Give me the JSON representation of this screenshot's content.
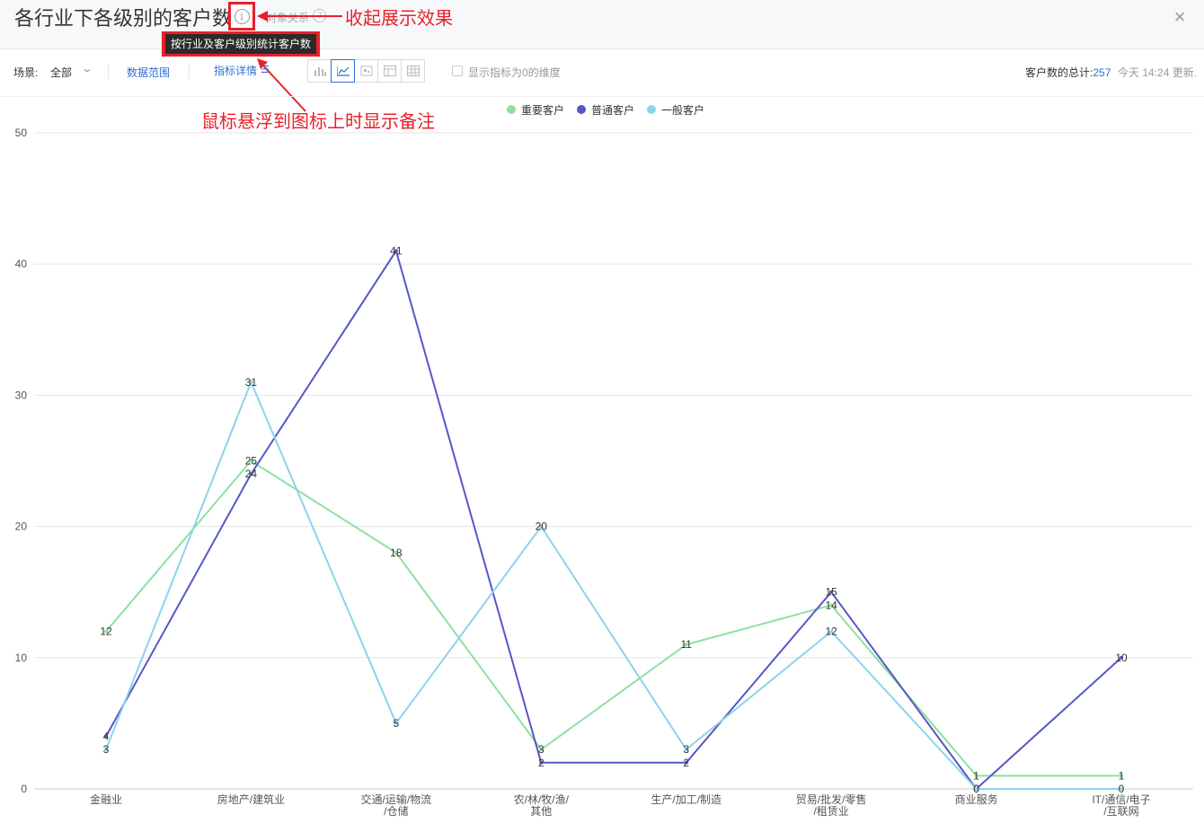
{
  "header": {
    "title": "各行业下各级别的客户数",
    "sub_label": "对象关系",
    "tooltip": "按行业及客户级别统计客户数",
    "annotation_collapse": "收起展示效果",
    "annotation_hover": "鼠标悬浮到图标上时显示备注"
  },
  "toolbar": {
    "scene_label": "场景:",
    "scene_value": "全部",
    "data_range": "数据范围",
    "metric_detail": "指标详情",
    "zero_checkbox_label": "显示指标为0的维度",
    "total_label": "客户数的总计:",
    "total_value": "257",
    "updated": "今天 14:24 更新."
  },
  "icons": [
    "info-icon",
    "help-icon",
    "close-icon",
    "chevron-down-icon",
    "list-icon",
    "bar-chart-icon",
    "line-chart-icon",
    "scatter-icon",
    "table-icon",
    "grid-icon"
  ],
  "colors": {
    "accent": "#2f6fd4",
    "annotation_red": "#e8202a",
    "series_important": "#8ee0a2",
    "series_normal": "#5558c8",
    "series_general": "#8dd3ec"
  },
  "chart_data": {
    "type": "line",
    "categories": [
      "金融业",
      "房地产/建筑业",
      "交通/运输/物流/仓储",
      "农/林/牧/渔/其他",
      "生产/加工/制造",
      "贸易/批发/零售/租赁业",
      "商业服务",
      "IT/通信/电子/互联网"
    ],
    "category_lines": [
      [
        "金融业"
      ],
      [
        "房地产/建筑业"
      ],
      [
        "交通/运输/物流",
        "/仓储"
      ],
      [
        "农/林/牧/渔/",
        "其他"
      ],
      [
        "生产/加工/制造"
      ],
      [
        "贸易/批发/零售",
        "/租赁业"
      ],
      [
        "商业服务"
      ],
      [
        "IT/通信/电子",
        "/互联网"
      ]
    ],
    "series": [
      {
        "name": "重要客户",
        "color": "#8ee0a2",
        "values": [
          12,
          25,
          18,
          3,
          11,
          14,
          1,
          1
        ]
      },
      {
        "name": "普通客户",
        "color": "#5558c8",
        "values": [
          4,
          24,
          41,
          2,
          2,
          15,
          0,
          10
        ]
      },
      {
        "name": "一般客户",
        "color": "#8dd3ec",
        "values": [
          3,
          31,
          5,
          20,
          3,
          12,
          0,
          0
        ]
      }
    ],
    "ylim": [
      0,
      50
    ],
    "yticks": [
      0,
      10,
      20,
      30,
      40,
      50
    ],
    "grid": true,
    "legend_position": "top-center"
  }
}
